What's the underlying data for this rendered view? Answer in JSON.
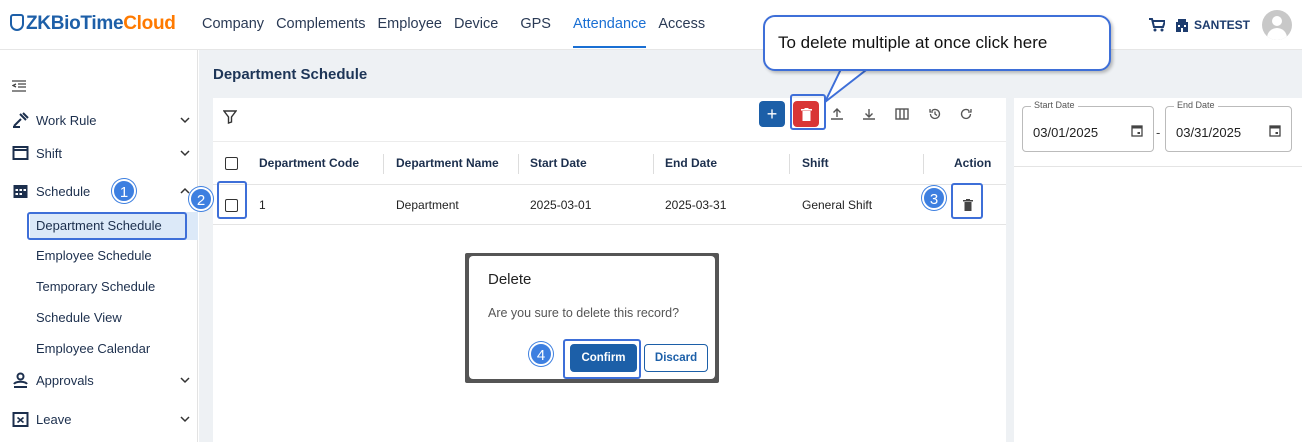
{
  "app": {
    "logo_brand": "ZKBioTime",
    "logo_cloud": "Cloud",
    "nav": [
      "Company",
      "Complements",
      "Employee",
      "Device",
      "GPS",
      "Attendance",
      "Access"
    ],
    "active_nav": "Attendance",
    "user": "SANTEST"
  },
  "sidebar": {
    "items": [
      {
        "label": "Work Rule",
        "icon": "work-rule-icon"
      },
      {
        "label": "Shift",
        "icon": "shift-icon"
      },
      {
        "label": "Schedule",
        "icon": "calendar-icon"
      },
      {
        "label": "Approvals",
        "icon": "approvals-icon"
      },
      {
        "label": "Leave",
        "icon": "leave-icon"
      }
    ],
    "sub_items": [
      "Department Schedule",
      "Employee Schedule",
      "Temporary Schedule",
      "Schedule View",
      "Employee Calendar"
    ],
    "active_sub": "Department Schedule"
  },
  "page": {
    "title": "Department Schedule"
  },
  "toolbar": {
    "add_label": "+"
  },
  "table": {
    "columns": [
      "Department Code",
      "Department Name",
      "Start Date",
      "End Date",
      "Shift",
      "Action"
    ],
    "rows": [
      {
        "code": "1",
        "name": "Department",
        "start": "2025-03-01",
        "end": "2025-03-31",
        "shift": "General Shift"
      }
    ]
  },
  "filters": {
    "start_date_label": "Start Date",
    "start_date_value": "03/01/2025",
    "separator": "-",
    "end_date_label": "End Date",
    "end_date_value": "03/31/2025"
  },
  "dialog": {
    "title": "Delete",
    "message": "Are you sure to delete this record?",
    "confirm_label": "Confirm",
    "discard_label": "Discard"
  },
  "annotations": {
    "callout": "To delete multiple at once click here",
    "badges": [
      "1",
      "2",
      "3",
      "4"
    ],
    "accent_color": "#3e6fd8"
  },
  "colors": {
    "primary": "#1c5fa8",
    "danger": "#d93636",
    "brand_orange": "#ff7a00"
  }
}
